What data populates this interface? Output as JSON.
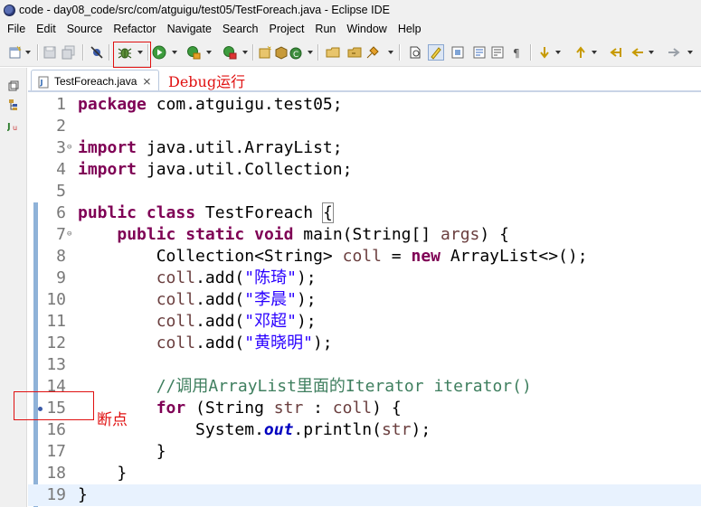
{
  "window": {
    "title": "code - day08_code/src/com/atguigu/test05/TestForeach.java - Eclipse IDE"
  },
  "menu": [
    "File",
    "Edit",
    "Source",
    "Refactor",
    "Navigate",
    "Search",
    "Project",
    "Run",
    "Window",
    "Help"
  ],
  "toolbar": {
    "icons": [
      "new-icon",
      "save-icon",
      "save-all-icon",
      "skip-breakpoints-icon",
      "debug-icon",
      "run-icon",
      "coverage-icon",
      "external-tools-icon",
      "new-java-project-icon",
      "new-package-icon",
      "new-class-icon",
      "open-type-icon",
      "open-task-icon",
      "search-icon",
      "toggle-mark-occurrences-icon",
      "highlight-icon",
      "block-selection-icon",
      "show-whitespace-icon",
      "next-annotation-icon",
      "previous-annotation-icon",
      "last-edit-icon",
      "back-icon",
      "forward-icon"
    ]
  },
  "editor": {
    "tab_label": "TestForeach.java",
    "tab_close": "⨯",
    "lines": [
      {
        "n": "1",
        "segments": [
          [
            "kw",
            "package"
          ],
          [
            "p",
            " com.atguigu.test05;"
          ]
        ]
      },
      {
        "n": "2",
        "segments": []
      },
      {
        "n": "3",
        "fold": "⊖",
        "segments": [
          [
            "kw",
            "import"
          ],
          [
            "p",
            " java.util.ArrayList;"
          ]
        ]
      },
      {
        "n": "4",
        "segments": [
          [
            "kw",
            "import"
          ],
          [
            "p",
            " java.util.Collection;"
          ]
        ]
      },
      {
        "n": "5",
        "segments": []
      },
      {
        "n": "6",
        "segments": [
          [
            "kw",
            "public"
          ],
          [
            "p",
            " "
          ],
          [
            "kw",
            "class"
          ],
          [
            "p",
            " TestForeach "
          ],
          [
            "brace",
            "{"
          ]
        ]
      },
      {
        "n": "7",
        "fold": "⊖",
        "segments": [
          [
            "p",
            "    "
          ],
          [
            "kw",
            "public"
          ],
          [
            "p",
            " "
          ],
          [
            "kw",
            "static"
          ],
          [
            "p",
            " "
          ],
          [
            "kw",
            "void"
          ],
          [
            "p",
            " main(String[] "
          ],
          [
            "var",
            "args"
          ],
          [
            "p",
            ") {"
          ]
        ]
      },
      {
        "n": "8",
        "segments": [
          [
            "p",
            "        Collection<String> "
          ],
          [
            "var",
            "coll"
          ],
          [
            "p",
            " = "
          ],
          [
            "kw",
            "new"
          ],
          [
            "p",
            " ArrayList<>();"
          ]
        ]
      },
      {
        "n": "9",
        "segments": [
          [
            "p",
            "        "
          ],
          [
            "var",
            "coll"
          ],
          [
            "p",
            ".add("
          ],
          [
            "str",
            "\"陈琦\""
          ],
          [
            "p",
            ");"
          ]
        ]
      },
      {
        "n": "10",
        "segments": [
          [
            "p",
            "        "
          ],
          [
            "var",
            "coll"
          ],
          [
            "p",
            ".add("
          ],
          [
            "str",
            "\"李晨\""
          ],
          [
            "p",
            ");"
          ]
        ]
      },
      {
        "n": "11",
        "segments": [
          [
            "p",
            "        "
          ],
          [
            "var",
            "coll"
          ],
          [
            "p",
            ".add("
          ],
          [
            "str",
            "\"邓超\""
          ],
          [
            "p",
            ");"
          ]
        ]
      },
      {
        "n": "12",
        "segments": [
          [
            "p",
            "        "
          ],
          [
            "var",
            "coll"
          ],
          [
            "p",
            ".add("
          ],
          [
            "str",
            "\"黄晓明\""
          ],
          [
            "p",
            ");"
          ]
        ]
      },
      {
        "n": "13",
        "segments": []
      },
      {
        "n": "14",
        "segments": [
          [
            "p",
            "        "
          ],
          [
            "cmt",
            "//调用ArrayList里面的Iterator iterator()"
          ]
        ]
      },
      {
        "n": "15",
        "breakpoint": true,
        "segments": [
          [
            "p",
            "        "
          ],
          [
            "kw",
            "for"
          ],
          [
            "p",
            " (String "
          ],
          [
            "var",
            "str"
          ],
          [
            "p",
            " : "
          ],
          [
            "var",
            "coll"
          ],
          [
            "p",
            ") {"
          ]
        ]
      },
      {
        "n": "16",
        "segments": [
          [
            "p",
            "            System."
          ],
          [
            "fld",
            "out"
          ],
          [
            "p",
            ".println("
          ],
          [
            "var",
            "str"
          ],
          [
            "p",
            ");"
          ]
        ]
      },
      {
        "n": "17",
        "segments": [
          [
            "p",
            "        }"
          ]
        ]
      },
      {
        "n": "18",
        "segments": [
          [
            "p",
            "    }"
          ]
        ]
      },
      {
        "n": "19",
        "current": true,
        "segments": [
          [
            "p",
            "}"
          ]
        ]
      }
    ]
  },
  "annotations": {
    "debug_label": "Debug运行",
    "breakpoint_label": "断点"
  },
  "colors": {
    "annotation": "#e01010",
    "keyword": "#7f0055",
    "string": "#2a00ff",
    "comment": "#3f7f5f"
  }
}
